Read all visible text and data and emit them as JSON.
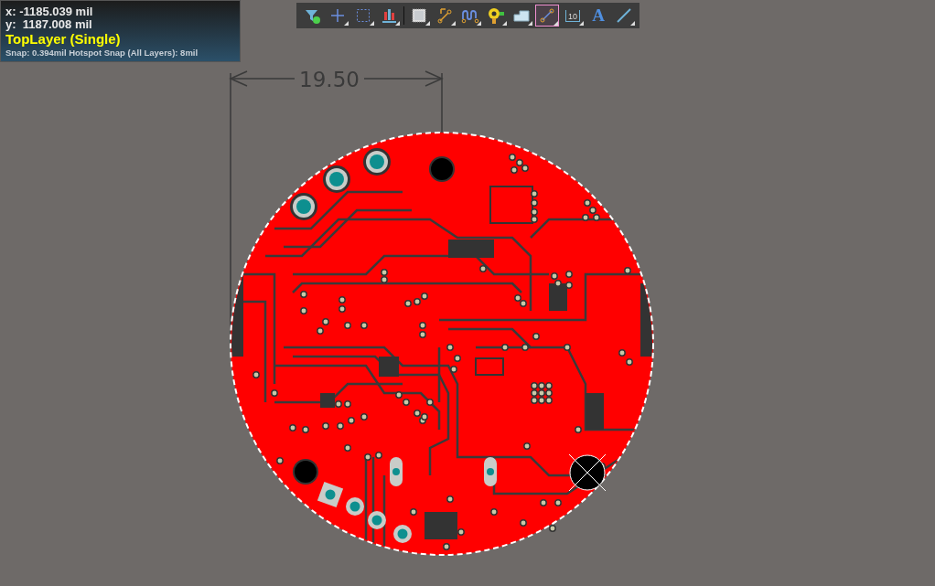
{
  "info": {
    "x": "x: -1185.039 mil",
    "y": "y:  1187.008 mil",
    "layer": "TopLayer (Single)",
    "snap": "Snap: 0.394mil Hotspot Snap (All Layers): 8mil"
  },
  "toolbar": [
    {
      "kind": "filter",
      "dropdown": false,
      "selected": false
    },
    {
      "kind": "crosshair",
      "dropdown": true,
      "selected": false
    },
    {
      "kind": "select-rect",
      "dropdown": true,
      "selected": false
    },
    {
      "kind": "align",
      "dropdown": true,
      "selected": false
    },
    {
      "kind": "separator"
    },
    {
      "kind": "component",
      "dropdown": true,
      "selected": false
    },
    {
      "kind": "route",
      "dropdown": true,
      "selected": false
    },
    {
      "kind": "tune",
      "dropdown": true,
      "selected": false
    },
    {
      "kind": "via",
      "dropdown": true,
      "selected": false
    },
    {
      "kind": "polygon",
      "dropdown": true,
      "selected": false
    },
    {
      "kind": "diffpair",
      "dropdown": true,
      "selected": true
    },
    {
      "kind": "dimension",
      "dropdown": true,
      "selected": false,
      "label": "10"
    },
    {
      "kind": "text",
      "dropdown": false,
      "selected": false,
      "label": "A"
    },
    {
      "kind": "line",
      "dropdown": true,
      "selected": false
    }
  ],
  "dimension": {
    "value": "19.50"
  }
}
